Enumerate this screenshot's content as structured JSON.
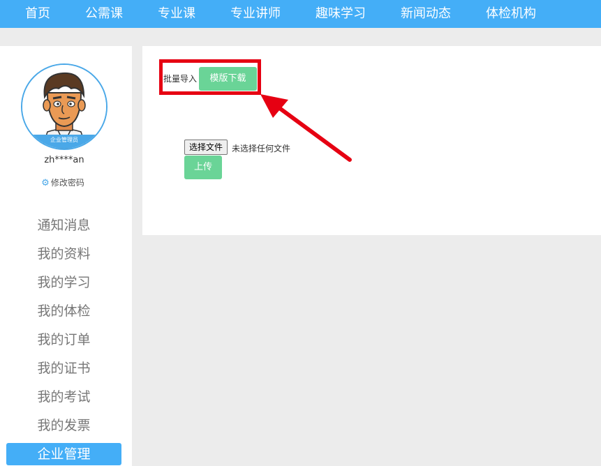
{
  "nav": {
    "items": [
      "首页",
      "公需课",
      "专业课",
      "专业讲师",
      "趣味学习",
      "新闻动态",
      "体检机构"
    ]
  },
  "profile": {
    "role": "企业管理员",
    "username": "zh****an",
    "change_password": "修改密码"
  },
  "sidebar": {
    "items": [
      "通知消息",
      "我的资料",
      "我的学习",
      "我的体检",
      "我的订单",
      "我的证书",
      "我的考试",
      "我的发票",
      "企业管理"
    ],
    "active": "企业管理"
  },
  "content": {
    "batch_import_label": "批量导入",
    "template_download": "模版下载",
    "choose_file": "选择文件",
    "no_file": "未选择任何文件",
    "upload": "上传"
  },
  "colors": {
    "primary": "#44aef7",
    "green_button": "#6ad497",
    "highlight": "#e60012"
  }
}
